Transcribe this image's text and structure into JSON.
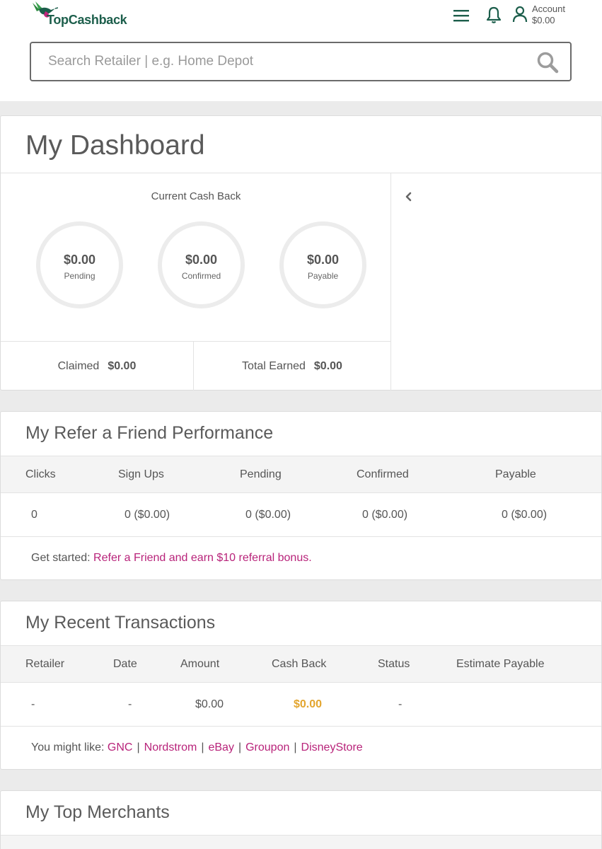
{
  "header": {
    "logo_text": "TopCashback",
    "account_label": "Account",
    "account_balance": "$0.00",
    "search_placeholder": "Search Retailer | e.g. Home Depot"
  },
  "dashboard": {
    "title": "My Dashboard",
    "current_cash_back_label": "Current Cash Back",
    "circles": [
      {
        "amount": "$0.00",
        "label": "Pending"
      },
      {
        "amount": "$0.00",
        "label": "Confirmed"
      },
      {
        "amount": "$0.00",
        "label": "Payable"
      }
    ],
    "claimed_label": "Claimed",
    "claimed_value": "$0.00",
    "total_earned_label": "Total Earned",
    "total_earned_value": "$0.00"
  },
  "refer": {
    "title": "My Refer a Friend Performance",
    "columns": [
      "Clicks",
      "Sign Ups",
      "Pending",
      "Confirmed",
      "Payable"
    ],
    "row": [
      "0",
      "0 ($0.00)",
      "0 ($0.00)",
      "0 ($0.00)",
      "0 ($0.00)"
    ],
    "footer_prefix": "Get started:",
    "footer_link": "Refer a Friend and earn $10 referral bonus."
  },
  "transactions": {
    "title": "My Recent Transactions",
    "columns": [
      "Retailer",
      "Date",
      "Amount",
      "Cash Back",
      "Status",
      "Estimate Payable"
    ],
    "row": [
      "-",
      "-",
      "$0.00",
      "$0.00",
      "-",
      ""
    ],
    "footer_prefix": "You might like:",
    "suggestions": [
      "GNC",
      "Nordstrom",
      "eBay",
      "Groupon",
      "DisneyStore"
    ],
    "separator": "|"
  },
  "top_merchants": {
    "title": "My Top Merchants"
  },
  "colors": {
    "brand_green": "#1c5e4b",
    "link_pink": "#b8237a",
    "cashback_orange": "#e3a52e"
  }
}
